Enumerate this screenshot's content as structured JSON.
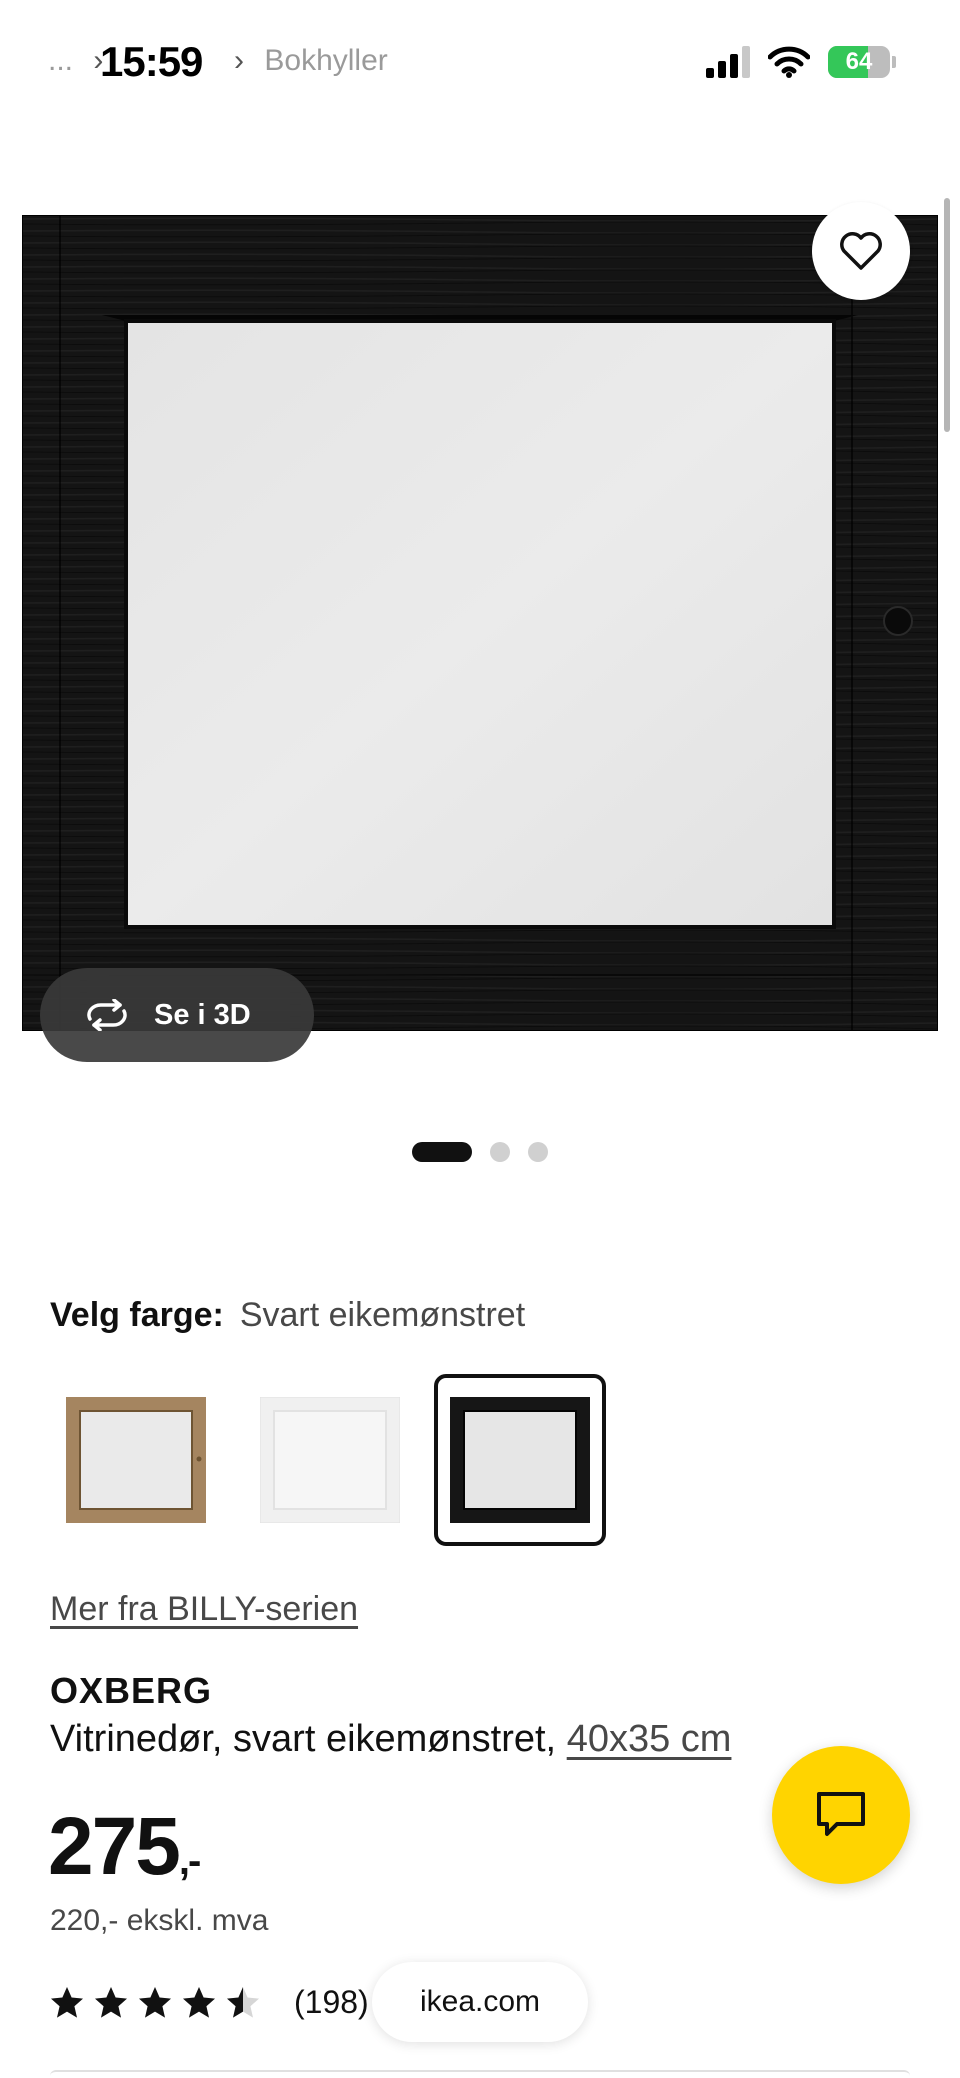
{
  "status_bar": {
    "breadcrumb_ellipsis": "...",
    "breadcrumb_separator": "›",
    "breadcrumb_current": "Bokhyller",
    "time": "15:59",
    "battery_level": 64,
    "battery_text": "64"
  },
  "gallery": {
    "view_3d_label": "Se i 3D",
    "page_count": 3,
    "active_page": 1
  },
  "colors": {
    "label": "Velg farge:",
    "selected": "Svart eikemønstret",
    "swatch_frame_colors": [
      "#a58560",
      "#f0f0f0",
      "#161616"
    ],
    "selected_index": 2
  },
  "series_link": "Mer fra BILLY-serien",
  "product": {
    "name": "OXBERG",
    "description": "Vitrinedør, svart eikemønstret,",
    "size": "40x35 cm",
    "price": "275",
    "price_suffix": ",-",
    "price_ex_vat": "220,- ekskl. mva",
    "rating": 4.5,
    "review_count": "(198)"
  },
  "browser": {
    "url": "ikea.com"
  },
  "theme": {
    "accent_yellow": "#ffd400",
    "text_dark": "#111111",
    "text_muted": "#484848"
  }
}
